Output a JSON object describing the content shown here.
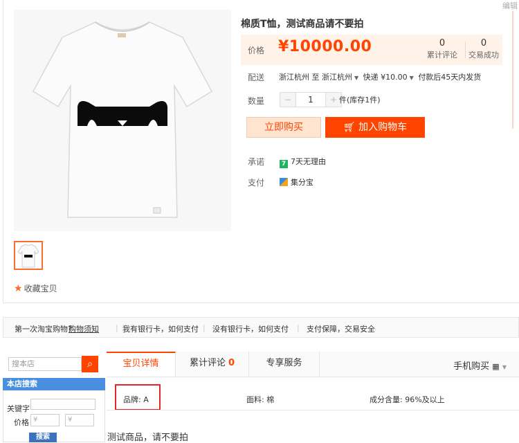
{
  "header": {
    "edit_label": "编辑"
  },
  "product": {
    "title": "棉质T恤，测试商品请不要拍",
    "price_label": "价格",
    "price": "¥10000.00",
    "reviews_count": "0",
    "reviews_label": "累计评论",
    "sales_count": "0",
    "sales_label": "交易成功",
    "shipping_label": "配送",
    "ship_from": "浙江杭州",
    "ship_to_word": "至",
    "ship_to": "浙江杭州",
    "ship_method": "快递 ¥10.00",
    "ship_note": "付款后45天内发货",
    "quantity_label": "数量",
    "quantity_value": "1",
    "minus_label": "−",
    "plus_label": "+",
    "stock_text": "件(库存1件)",
    "buy_now_label": "立即购买",
    "add_cart_label": "加入购物车",
    "promise_label": "承诺",
    "promise_icon_text": "7",
    "promise_text": "7天无理由",
    "payment_label": "支付",
    "payment_text": "集分宝",
    "favorite_label": "收藏宝贝"
  },
  "guide": {
    "first_time": "第一次淘宝购物?",
    "guide_link": "购物须知",
    "item1": "我有银行卡，如何支付",
    "item2": "没有银行卡，如何支付",
    "item3": "支付保障，交易安全"
  },
  "sidebar": {
    "search_placeholder": "搜本店",
    "section_title": "本店搜索",
    "keyword_label": "关键字",
    "price_label": "价格",
    "price_min_placeholder": "¥",
    "price_max_placeholder": "¥",
    "search_button": "搜索"
  },
  "tabs": {
    "details": "宝贝详情",
    "reviews": "累计评论",
    "reviews_count": "0",
    "services": "专享服务",
    "mobile_buy": "手机购买"
  },
  "attributes": {
    "brand": "品牌: A",
    "fabric": "面料: 棉",
    "composition": "成分含量: 96%及以上"
  },
  "description": "测试商品，请不要拍",
  "colors": {
    "accent": "#ff4400",
    "price_bg": "#fff2e8",
    "sidebar_head": "#4a8ee0",
    "highlight_box": "#e4262a"
  }
}
